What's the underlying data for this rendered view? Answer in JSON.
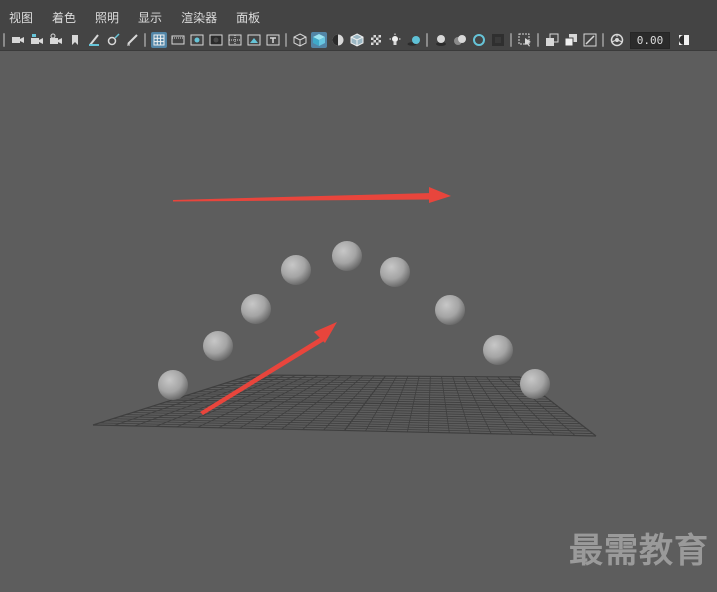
{
  "menu": [
    "视图",
    "着色",
    "照明",
    "显示",
    "渲染器",
    "面板"
  ],
  "toolbar": {
    "icons": [
      "camera-icon",
      "camera-select-icon",
      "camera-lock-icon",
      "bookmark-icon",
      "grease-pencil-icon",
      "transform-pivot-icon",
      "pen-icon",
      "grid-icon",
      "film-gate-icon",
      "resolution-gate-icon",
      "gate-mask-icon",
      "field-chart-icon",
      "safe-action-icon",
      "safe-title-icon",
      "wireframe-icon",
      "smooth-shade-icon",
      "default-material-icon",
      "wireframe-on-shaded-icon",
      "textured-icon",
      "use-all-lights-icon",
      "shadows-icon",
      "screen-space-ao-icon",
      "motion-blur-icon",
      "multisample-aa-icon",
      "depth-of-field-icon",
      "isolate-select-icon",
      "xray-icon",
      "xray-active-icon",
      "xray-joints-icon",
      "exposure-icon",
      "gamma-icon"
    ],
    "exposure_value": "0.00"
  },
  "watermark": "最需教育",
  "colors": {
    "ui_bg": "#444444",
    "viewport_bg": "#5d5d5d",
    "active_icon": "#5285a6",
    "arrow": "#e8453c",
    "grid": "#3f3f3f"
  }
}
